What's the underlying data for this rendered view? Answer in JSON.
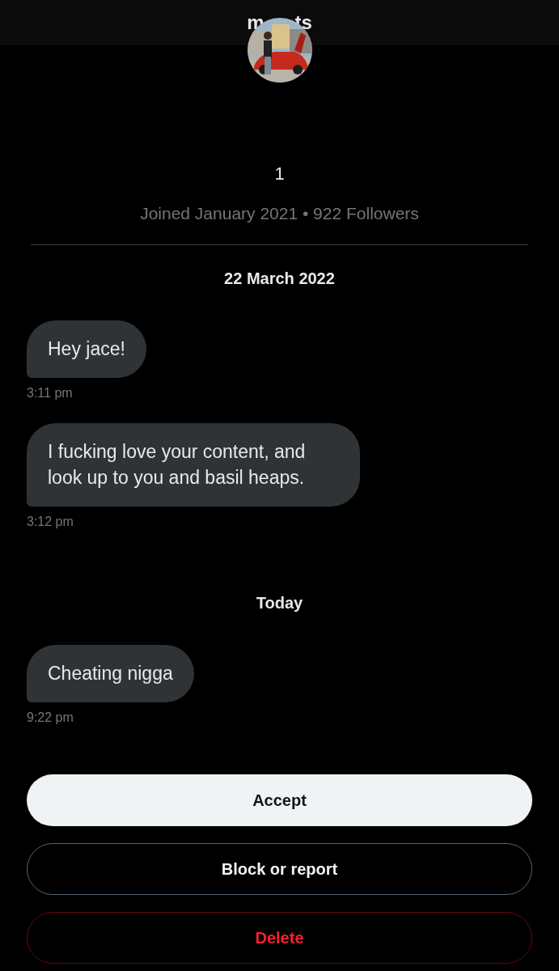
{
  "header": {
    "title_fragments": [
      "m",
      "ts"
    ],
    "avatar": {
      "kind": "picture"
    }
  },
  "profile": {
    "name": "1",
    "meta": "Joined January 2021 • 922 Followers"
  },
  "conversation": [
    {
      "kind": "date",
      "text": "22 March 2022"
    },
    {
      "kind": "message",
      "text": "Hey jace!",
      "time": "3:11 pm"
    },
    {
      "kind": "message",
      "text": "I fucking love your content, and look up to you and basil heaps.",
      "time": "3:12 pm"
    },
    {
      "kind": "date",
      "text": "Today"
    },
    {
      "kind": "message",
      "text": "Cheating nigga",
      "time": "9:22 pm"
    }
  ],
  "actions": [
    {
      "label": "Accept",
      "kind": "primary"
    },
    {
      "label": "Block or report",
      "kind": "outline"
    },
    {
      "label": "Delete",
      "kind": "danger"
    }
  ]
}
